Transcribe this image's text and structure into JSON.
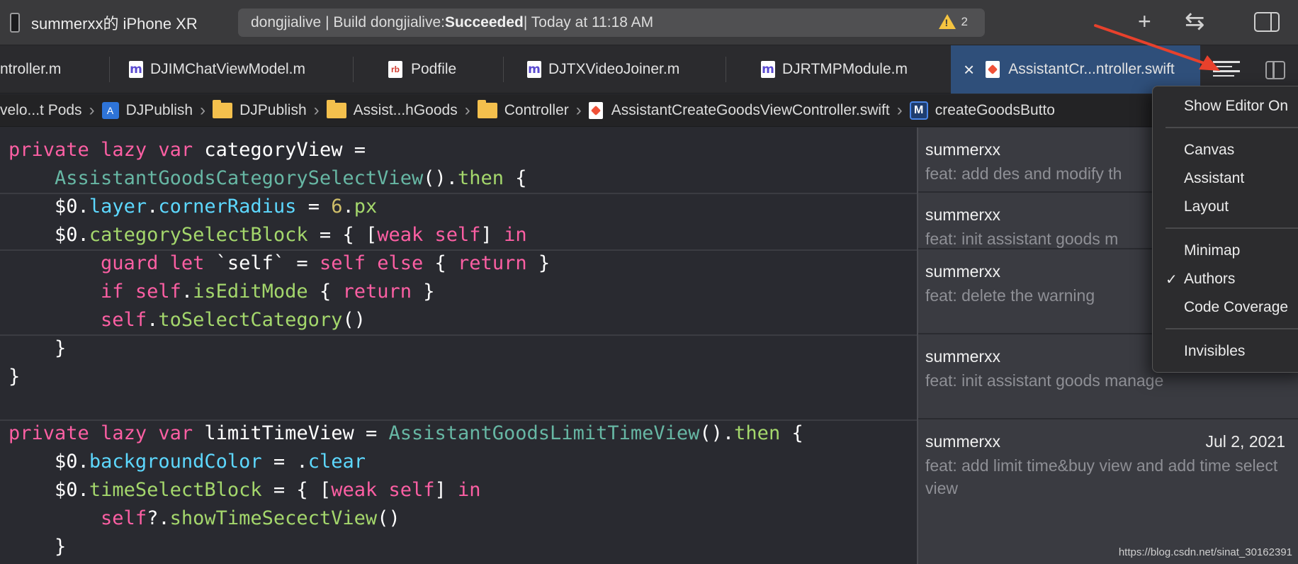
{
  "toolbar": {
    "scheme": "summerxx的 iPhone XR",
    "activity_prefix": "dongjialive | Build dongjialive: ",
    "activity_status": "Succeeded",
    "activity_suffix": " | Today at 11:18 AM",
    "warning_count": "2",
    "add_symbol": "+",
    "back_forward_symbol": "⇆"
  },
  "tabs": [
    {
      "label": "ntroller.m"
    },
    {
      "label": "DJIMChatViewModel.m"
    },
    {
      "label": "Podfile"
    },
    {
      "label": "DJTXVideoJoiner.m"
    },
    {
      "label": "DJRTMPModule.m"
    },
    {
      "label": "AssistantCr...ntroller.swift",
      "active": true
    }
  ],
  "breadcrumb": [
    "velo...t Pods",
    "DJPublish",
    "DJPublish",
    "Assist...hGoods",
    "Controller",
    "AssistantCreateGoodsViewController.swift",
    "createGoodsButto"
  ],
  "code": {
    "l1a": "private",
    "l1b": "lazy",
    "l1c": "var",
    "l1d": " categoryView =",
    "l2a": "AssistantGoodsCategorySelectView",
    "l2b": "().",
    "l2c": "then",
    "l2d": " {",
    "l3a": "$0.",
    "l3b": "layer",
    "l3c": ".",
    "l3d": "cornerRadius",
    "l3e": " = ",
    "l3f": "6",
    "l3g": ".",
    "l3h": "px",
    "l4a": "$0.",
    "l4b": "categorySelectBlock",
    "l4c": " = { [",
    "l4d": "weak",
    "l4e": "self",
    "l4f": "] ",
    "l4g": "in",
    "l5a": "guard",
    "l5b": "let",
    "l5c": " `self` = ",
    "l5d": "self",
    "l5e": "else",
    "l5f": " { ",
    "l5g": "return",
    "l5h": " }",
    "l6a": "if",
    "l6b": "self",
    "l6c": ".",
    "l6d": "isEditMode",
    "l6e": " { ",
    "l6f": "return",
    "l6g": " }",
    "l7a": "self",
    "l7b": ".",
    "l7c": "toSelectCategory",
    "l7d": "()",
    "l8": "}",
    "l9": "}",
    "l10a": "private",
    "l10b": "lazy",
    "l10c": "var",
    "l10d": " limitTimeView = ",
    "l10e": "AssistantGoodsLimitTimeView",
    "l10f": "().",
    "l10g": "then",
    "l10h": " {",
    "l11a": "$0.",
    "l11b": "backgroundColor",
    "l11c": " = .",
    "l11d": "clear",
    "l12a": "$0.",
    "l12b": "timeSelectBlock",
    "l12c": " = { [",
    "l12d": "weak",
    "l12e": "self",
    "l12f": "] ",
    "l12g": "in",
    "l13a": "self",
    "l13b": "?.",
    "l13c": "showTimeSecectView",
    "l13d": "()",
    "l14": "}"
  },
  "authors": [
    {
      "name": "summerxx",
      "msg": "feat: add des and modify th"
    },
    {
      "name": "summerxx",
      "msg": "feat: init assistant goods m"
    },
    {
      "name": "summerxx",
      "msg": "feat: delete the warning"
    },
    {
      "name": "summerxx",
      "msg": "feat: init assistant goods manage"
    },
    {
      "name": "summerxx",
      "date": "Jul 2, 2021",
      "msg": "feat: add limit time&buy view and add time select view"
    }
  ],
  "menu": {
    "show_editor": "Show Editor On",
    "canvas": "Canvas",
    "assistant": "Assistant",
    "layout": "Layout",
    "minimap": "Minimap",
    "authors": "Authors",
    "code_coverage": "Code Coverage",
    "invisibles": "Invisibles",
    "checkmark": "✓"
  },
  "watermark": "https://blog.csdn.net/sinat_30162391",
  "colors": {
    "keyword": "#fc5fa3",
    "type": "#9ef1dd",
    "property": "#5dd8ff",
    "method": "#a4d76c",
    "number": "#d0bf69",
    "active_tab": "#2f4f7a",
    "annotation_arrow": "#e8412c"
  }
}
